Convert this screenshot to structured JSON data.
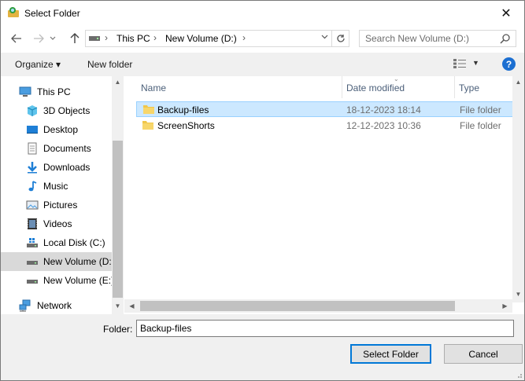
{
  "window": {
    "title": "Select Folder",
    "close_glyph": "✕"
  },
  "address": {
    "crumbs": [
      "This PC",
      "New Volume (D:)"
    ],
    "search_placeholder": "Search New Volume (D:)"
  },
  "toolbar": {
    "organize_label": "Organize ▾",
    "new_folder_label": "New folder",
    "help_glyph": "?"
  },
  "nav": {
    "items": [
      {
        "label": "This PC",
        "icon": "pc-icon"
      },
      {
        "label": "3D Objects",
        "icon": "cube-icon"
      },
      {
        "label": "Desktop",
        "icon": "desktop-icon"
      },
      {
        "label": "Documents",
        "icon": "documents-icon"
      },
      {
        "label": "Downloads",
        "icon": "downloads-icon"
      },
      {
        "label": "Music",
        "icon": "music-icon"
      },
      {
        "label": "Pictures",
        "icon": "pictures-icon"
      },
      {
        "label": "Videos",
        "icon": "videos-icon"
      },
      {
        "label": "Local Disk (C:)",
        "icon": "drive-icon"
      },
      {
        "label": "New Volume (D:",
        "icon": "drive-icon",
        "selected": true
      },
      {
        "label": "New Volume (E:)",
        "icon": "drive-icon"
      },
      {
        "label": "Network",
        "icon": "network-icon"
      }
    ]
  },
  "content": {
    "columns": [
      "Name",
      "Date modified",
      "Type"
    ],
    "rows": [
      {
        "name": "Backup-files",
        "date": "18-12-2023 18:14",
        "type": "File folder",
        "selected": true
      },
      {
        "name": "ScreenShorts",
        "date": "12-12-2023 10:36",
        "type": "File folder"
      }
    ]
  },
  "footer": {
    "folder_label": "Folder:",
    "folder_value": "Backup-files",
    "select_label": "Select Folder",
    "cancel_label": "Cancel"
  },
  "colors": {
    "accent": "#0078d7",
    "selection": "#cce8ff",
    "folder": "#f0c64a"
  }
}
